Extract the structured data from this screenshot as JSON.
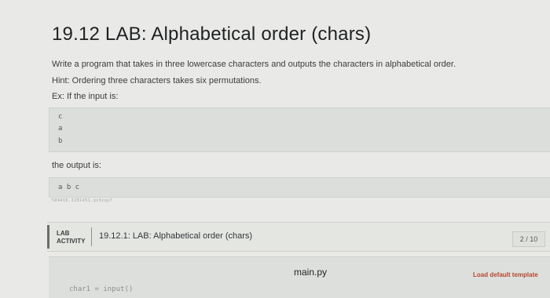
{
  "title": "19.12 LAB: Alphabetical order (chars)",
  "description": {
    "line1": "Write a program that takes in three lowercase characters and outputs the characters in alphabetical order.",
    "line2": "Hint: Ordering three characters takes six permutations.",
    "line3": "Ex: If the input is:"
  },
  "example_input": [
    "c",
    "a",
    "b"
  ],
  "output_label": "the output is:",
  "example_output": "a b c",
  "caption_id": "504416.2201451.qx3zqy7",
  "lab": {
    "label_line1": "LAB",
    "label_line2": "ACTIVITY",
    "title": "19.12.1: LAB: Alphabetical order (chars)",
    "score": "2 / 10"
  },
  "editor": {
    "file_name": "main.py",
    "load_default": "Load default template",
    "code_peek": "char1 = input()"
  }
}
